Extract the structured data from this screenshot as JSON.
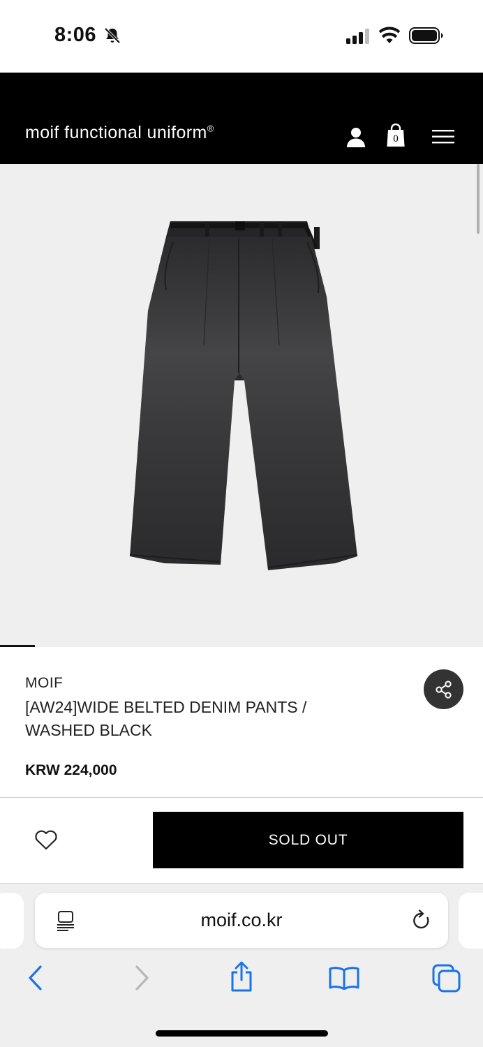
{
  "status_bar": {
    "time": "8:06",
    "icons": [
      "bell-slash-icon",
      "cellular-signal-icon",
      "wifi-icon",
      "battery-icon"
    ]
  },
  "header": {
    "logo": "moif functional uniform",
    "logo_mark": "®",
    "cart_count": "0",
    "icons": [
      "user-icon",
      "shopping-bag-icon",
      "hamburger-menu-icon"
    ]
  },
  "product": {
    "brand": "MOIF",
    "name": "[AW24]WIDE BELTED DENIM PANTS / WASHED BLACK",
    "price": "KRW 224,000",
    "image": "black wide belted denim pants"
  },
  "actions": {
    "sold_out_label": "SOLD OUT",
    "icons": [
      "heart-icon",
      "share-icon"
    ]
  },
  "browser": {
    "url": "moif.co.kr",
    "icons": [
      "reader-icon",
      "reload-icon",
      "back-icon",
      "forward-icon",
      "share-icon",
      "bookmarks-icon",
      "tabs-icon"
    ]
  },
  "colors": {
    "header_bg": "#000000",
    "image_bg": "#efefef",
    "accent_blue": "#1a73e8",
    "button_bg": "#000000"
  }
}
